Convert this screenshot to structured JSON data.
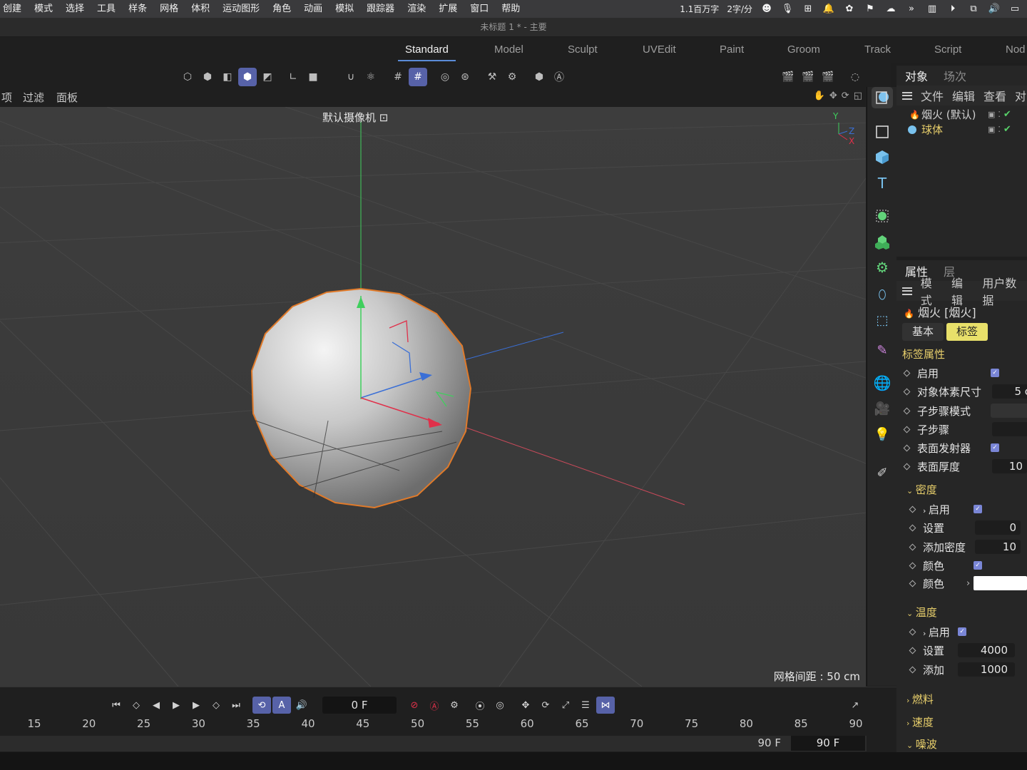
{
  "menubar": {
    "items": [
      "创建",
      "模式",
      "选择",
      "工具",
      "样条",
      "网格",
      "体积",
      "运动图形",
      "角色",
      "动画",
      "模拟",
      "跟踪器",
      "渲染",
      "扩展",
      "窗口",
      "帮助"
    ],
    "status_text": "1.1百万字",
    "rate_text": "2字/分"
  },
  "window": {
    "title": "未标题 1 * - 主要"
  },
  "layout_tabs": [
    "Standard",
    "Model",
    "Sculpt",
    "UVEdit",
    "Paint",
    "Groom",
    "Track",
    "Script",
    "Nod"
  ],
  "viewport_menu": [
    "项",
    "过滤",
    "面板"
  ],
  "viewport": {
    "camera_label": "默认摄像机",
    "grid_label": "网格间距 : 50 cm"
  },
  "objects_panel": {
    "tabs": [
      "对象",
      "场次"
    ],
    "menu": [
      "文件",
      "编辑",
      "查看",
      "对"
    ],
    "items": [
      {
        "name": "烟火 (默认)",
        "color": "#cfcfcf"
      },
      {
        "name": "球体",
        "color": "#e8cf6b"
      }
    ]
  },
  "attributes_panel": {
    "tabs": [
      "属性",
      "层"
    ],
    "menu": [
      "模式",
      "编辑",
      "用户数据"
    ],
    "object_title": "烟火 [烟火]",
    "subtabs": [
      "基本",
      "标签"
    ],
    "section_title": "标签属性",
    "rows": [
      {
        "label": "启用",
        "type": "checkbox"
      },
      {
        "label": "对象体素尺寸",
        "value": "5 c"
      },
      {
        "label": "子步骤模式",
        "value": ""
      },
      {
        "label": "子步骤",
        "value": ""
      },
      {
        "label": "表面发射器",
        "type": "checkbox"
      },
      {
        "label": "表面厚度",
        "value": "10"
      }
    ],
    "density": {
      "title": "密度",
      "rows": [
        {
          "label": "启用",
          "type": "checkbox"
        },
        {
          "label": "设置",
          "value": "0"
        },
        {
          "label": "添加密度",
          "value": "10"
        },
        {
          "label": "颜色",
          "type": "checkbox"
        },
        {
          "label": "颜色",
          "type": "color",
          "value": "#ffffff"
        }
      ]
    },
    "temperature": {
      "title": "温度",
      "rows": [
        {
          "label": "启用",
          "type": "checkbox"
        },
        {
          "label": "设置",
          "value": "4000"
        },
        {
          "label": "添加",
          "value": "1000"
        }
      ]
    },
    "collapsed_sections": [
      "燃料",
      "速度",
      "噪波"
    ]
  },
  "timeline": {
    "current_frame": "0 F",
    "ruler_ticks": [
      "15",
      "20",
      "25",
      "30",
      "35",
      "40",
      "45",
      "50",
      "55",
      "60",
      "65",
      "70",
      "75",
      "80",
      "85",
      "90"
    ],
    "range_end": "90 F",
    "range_end_field": "90 F"
  },
  "colors": {
    "accent": "#5762a8",
    "selection": "#e8cf6b",
    "tab_underline": "#5b8cd8",
    "sphere_outline": "#e07a2a"
  }
}
